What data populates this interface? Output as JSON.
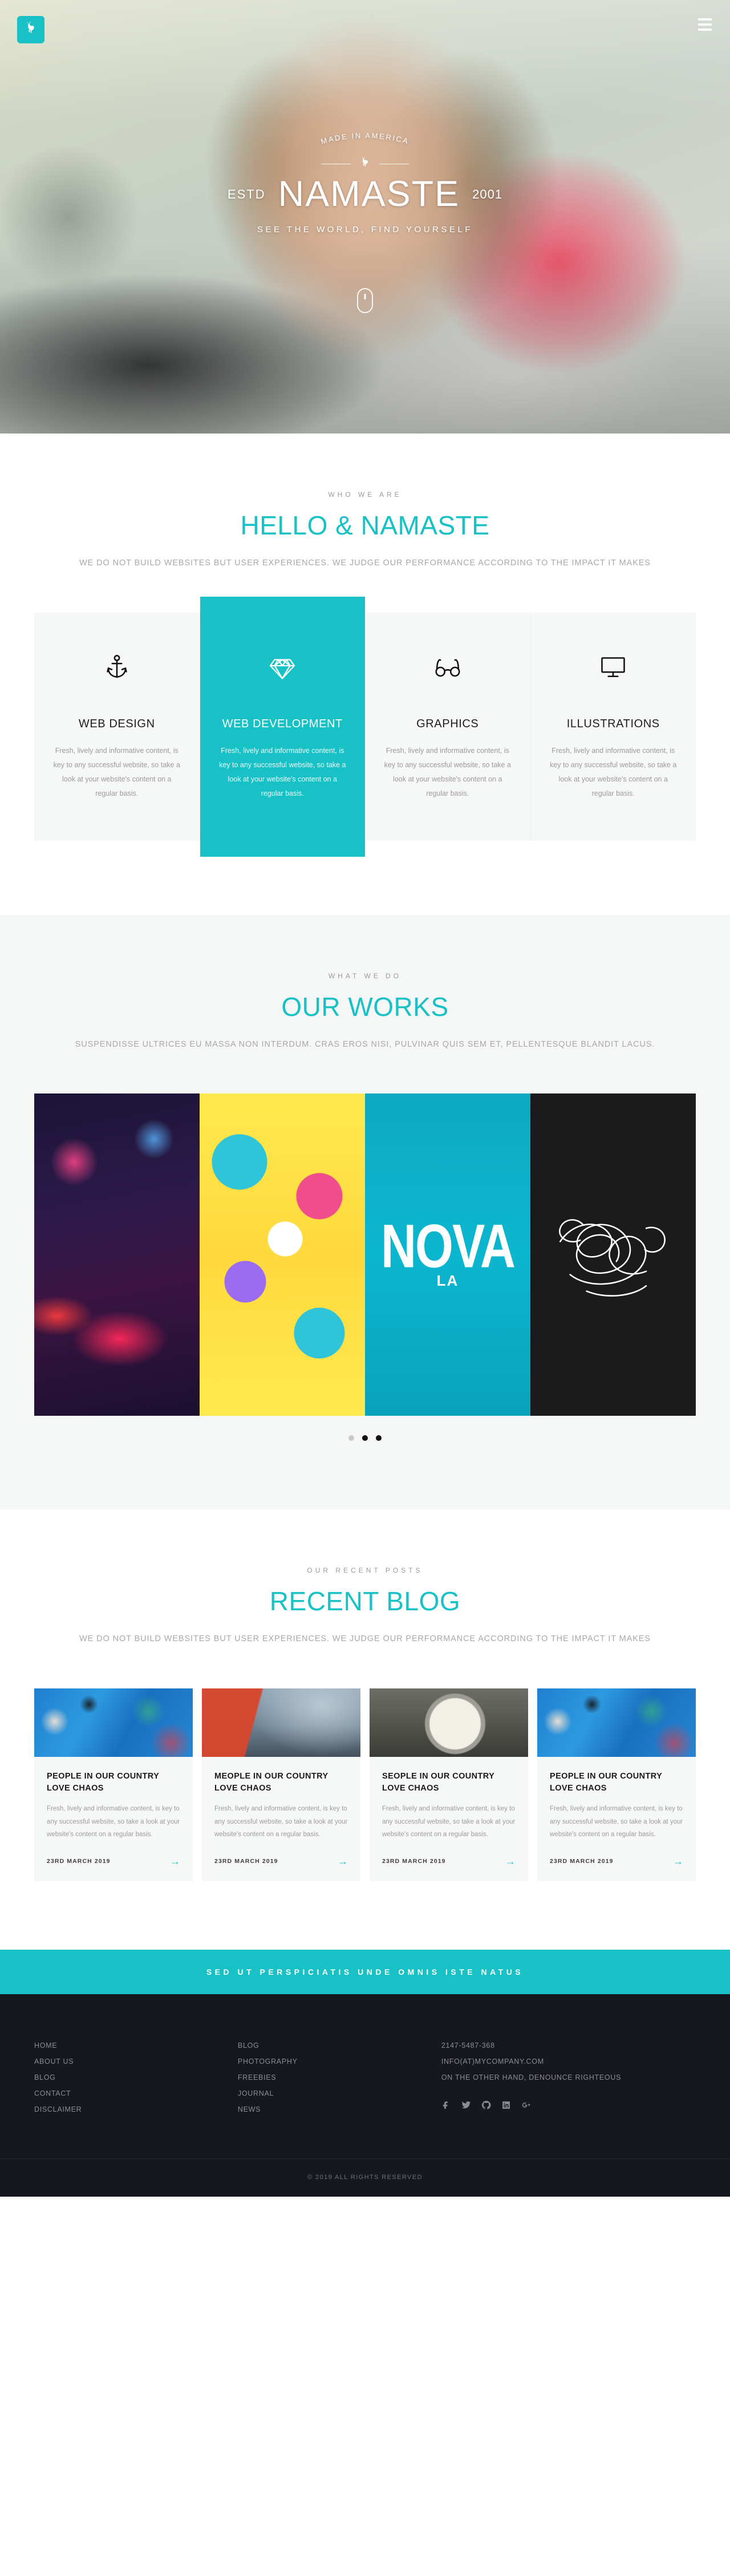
{
  "brand": {
    "accent": "#17c1c6",
    "logo_icon": "deer-icon"
  },
  "hero": {
    "menu_icon": "hamburger-menu-icon",
    "made_in": "MADE IN AMERICA",
    "estd": "ESTD",
    "name": "NAMASTE",
    "year": "2001",
    "tagline": "SEE THE WORLD, FIND YOURSELF",
    "scroll_icon": "mouse-scroll-icon"
  },
  "about": {
    "eyebrow": "WHO WE ARE",
    "title": "HELLO & NAMASTE",
    "subtitle": "WE DO NOT BUILD WEBSITES BUT USER EXPERIENCES. WE JUDGE OUR PERFORMANCE ACCORDING TO THE IMPACT IT MAKES",
    "services": [
      {
        "icon": "anchor-icon",
        "title": "WEB DESIGN",
        "text": "Fresh, lively and informative content, is key to any successful website, so take a look at your website's content on a regular basis.",
        "active": false
      },
      {
        "icon": "diamond-icon",
        "title": "WEB DEVELOPMENT",
        "text": "Fresh, lively and informative content, is key to any successful website, so take a look at your website's content on a regular basis.",
        "active": true
      },
      {
        "icon": "glasses-icon",
        "title": "GRAPHICS",
        "text": "Fresh, lively and informative content, is key to any successful website, so take a look at your website's content on a regular basis.",
        "active": false
      },
      {
        "icon": "monitor-icon",
        "title": "ILLUSTRATIONS",
        "text": "Fresh, lively and informative content, is key to any successful website, so take a look at your website's content on a regular basis.",
        "active": false
      }
    ]
  },
  "works": {
    "eyebrow": "WHAT WE DO",
    "title": "OUR WORKS",
    "subtitle": "SUSPENDISSE ULTRICES EU MASSA NON INTERDUM. CRAS EROS NISI, PULVINAR QUIS SEM ET, PELLENTESQUE BLANDIT LACUS.",
    "items": [
      {
        "name": "neon-car-photo"
      },
      {
        "name": "colorful-monsters-illustration"
      },
      {
        "name": "nova-typography-poster",
        "label": "NOVA",
        "sublabel": "LA"
      },
      {
        "name": "time-scribble-poster",
        "label": "time"
      }
    ],
    "dots": [
      "inactive",
      "active",
      "active"
    ]
  },
  "blog": {
    "eyebrow": "OUR RECENT POSTS",
    "title": "RECENT BLOG",
    "subtitle": "WE DO NOT BUILD WEBSITES BUT USER EXPERIENCES. WE JUDGE OUR PERFORMANCE ACCORDING TO THE IMPACT IT MAKES",
    "posts": [
      {
        "title": "PEOPLE IN OUR COUNTRY LOVE CHAOS",
        "text": "Fresh, lively and informative content, is key to any successful website, so take a look at your website's content on a regular basis.",
        "date": "23RD MARCH 2019",
        "arrow": "→"
      },
      {
        "title": "MEOPLE IN OUR COUNTRY LOVE CHAOS",
        "text": "Fresh, lively and informative content, is key to any successful website, so take a look at your website's content on a regular basis.",
        "date": "23RD MARCH 2019",
        "arrow": "→"
      },
      {
        "title": "SEOPLE IN OUR COUNTRY LOVE CHAOS",
        "text": "Fresh, lively and informative content, is key to any successful website, so take a look at your website's content on a regular basis.",
        "date": "23RD MARCH 2019",
        "arrow": "→"
      },
      {
        "title": "PEOPLE IN OUR COUNTRY LOVE CHAOS",
        "text": "Fresh, lively and informative content, is key to any successful website, so take a look at your website's content on a regular basis.",
        "date": "23RD MARCH 2019",
        "arrow": "→"
      }
    ]
  },
  "cta": {
    "text": "SED UT PERSPICIATIS UNDE OMNIS ISTE NATUS"
  },
  "footer": {
    "col1": [
      "HOME",
      "ABOUT US",
      "BLOG",
      "CONTACT",
      "DISCLAIMER"
    ],
    "col2": [
      "BLOG",
      "PHOTOGRAPHY",
      "FREEBIES",
      "JOURNAL",
      "NEWS"
    ],
    "contact": [
      "2147-5487-368",
      "INFO(AT)MYCOMPANY.COM",
      "ON THE OTHER HAND, DENOUNCE RIGHTEOUS"
    ],
    "socials": [
      "facebook-icon",
      "twitter-icon",
      "github-icon",
      "linkedin-icon",
      "googleplus-icon"
    ],
    "copyright": "© 2019 ALL RIGHTS RESERVED"
  }
}
